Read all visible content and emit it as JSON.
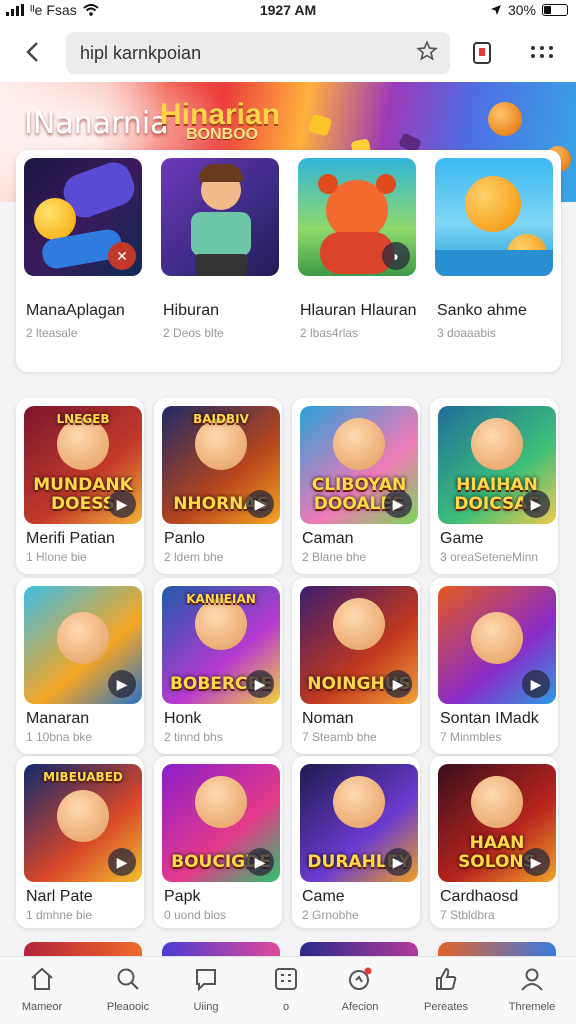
{
  "status": {
    "carrier": "ᴵᴵe Fsas",
    "time": "1927 AM",
    "battery": "30%",
    "battery_level": 0.3
  },
  "header": {
    "search_value": "hipl karnkpoian",
    "back_icon": "chevron-left-icon",
    "star_icon": "star-icon",
    "page_icon": "page-icon",
    "more_icon": "more-icon"
  },
  "banner": {
    "title_left": "INanarnia",
    "title_right": "Hinarian",
    "title_small": "BONBOO"
  },
  "featured": [
    {
      "name": "ManaAplagan",
      "sub": "2 lteasale"
    },
    {
      "name": "Hiburan",
      "sub": "2 Deos blte"
    },
    {
      "name": "Hlauran Hlauran",
      "sub": "2 lbas4rlas"
    },
    {
      "name": "Sanko ahme",
      "sub": "3 doaaabis"
    }
  ],
  "grid": [
    {
      "name": "Merifi Patian",
      "sub": "1 Hlone bie",
      "art": "MUNDANK DOESS",
      "top": "LNEGEB"
    },
    {
      "name": "Panlo",
      "sub": "2 ldem bhe",
      "art": "NHORNAS",
      "top": "BAIDBIV"
    },
    {
      "name": "Caman",
      "sub": "2 Blane bhe",
      "art": "CLIBOYAN DOOALES",
      "top": ""
    },
    {
      "name": "Game",
      "sub": "3 oreaSeteneMinn",
      "art": "HIAIHAN DOICSAS",
      "top": ""
    },
    {
      "name": "Manaran",
      "sub": "1 10bna bke",
      "art": "",
      "top": ""
    },
    {
      "name": "Honk",
      "sub": "2 tinnd bhs",
      "art": "BOBERCBE",
      "top": "KANIIEIAN"
    },
    {
      "name": "Noman",
      "sub": "7 Steamb bhe",
      "art": "NOINGHUS",
      "top": ""
    },
    {
      "name": "Sontan IMadk",
      "sub": "7 Minmbles",
      "art": "",
      "top": ""
    },
    {
      "name": "Narl Pate",
      "sub": "1 dmhne bie",
      "art": "",
      "top": "MIBEUABED"
    },
    {
      "name": "Papk",
      "sub": "0 uond blos",
      "art": "BOUCIGDE",
      "top": ""
    },
    {
      "name": "Came",
      "sub": "2 Grnobhe",
      "art": "DURAHLEY",
      "top": ""
    },
    {
      "name": "Cardhaosd",
      "sub": "7 Stbldbra",
      "art": "HAAN SOLONS",
      "top": ""
    }
  ],
  "nav": [
    {
      "label": "Mameor",
      "icon": "home-icon"
    },
    {
      "label": "Pleaooic",
      "icon": "search-icon"
    },
    {
      "label": "Uiing",
      "icon": "chat-icon"
    },
    {
      "label": "o",
      "icon": "grid-icon"
    },
    {
      "label": "Afecion",
      "icon": "notification-icon"
    },
    {
      "label": "Pereates",
      "icon": "thumbs-up-icon"
    },
    {
      "label": "Thremele",
      "icon": "profile-icon"
    }
  ]
}
